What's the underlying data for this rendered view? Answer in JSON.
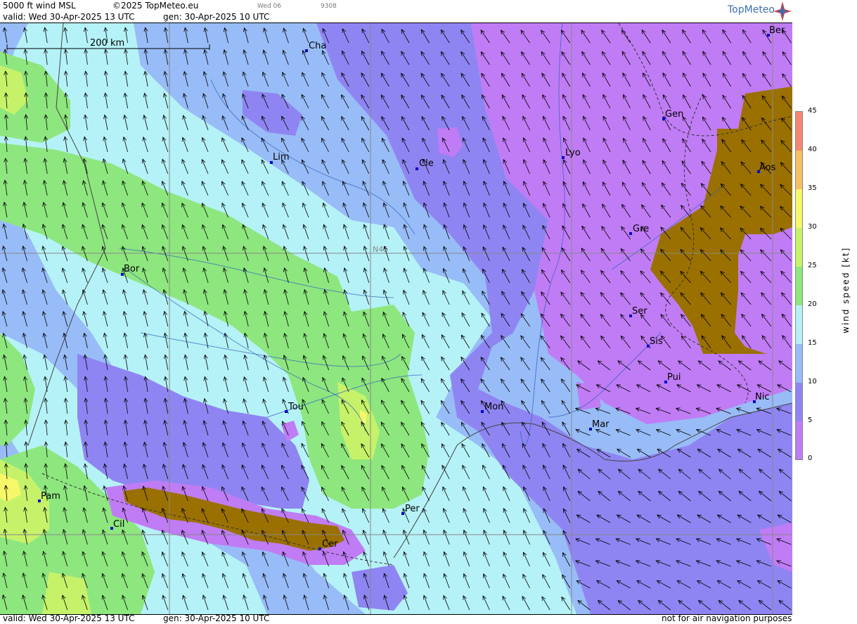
{
  "header": {
    "title": "5000 ft wind MSL",
    "copyright": "©2025 TopMeteo.eu",
    "valid": "valid:  Wed  30-Apr-2025  13 UTC",
    "gen": "gen: 30-Apr-2025 10 UTC",
    "small_day": "Wed 06",
    "small_code": "9308",
    "logo": "TopMeteo"
  },
  "footer": {
    "valid": "valid:  Wed  30-Apr-2025  13 UTC",
    "gen": "gen: 30-Apr-2025 10 UTC",
    "disclaimer": "not for air navigation purposes"
  },
  "map": {
    "scale_bar_label": "200 km",
    "lat_label": "N45",
    "cities": [
      {
        "name": "Cha"
      },
      {
        "name": "Lim"
      },
      {
        "name": "Cle"
      },
      {
        "name": "Lyo"
      },
      {
        "name": "Gen"
      },
      {
        "name": "Ber"
      },
      {
        "name": "Aos"
      },
      {
        "name": "Gre"
      },
      {
        "name": "Bor"
      },
      {
        "name": "Ser"
      },
      {
        "name": "Sis"
      },
      {
        "name": "Pui"
      },
      {
        "name": "Nic"
      },
      {
        "name": "Tou"
      },
      {
        "name": "Mon"
      },
      {
        "name": "Mar"
      },
      {
        "name": "Pam"
      },
      {
        "name": "Cil"
      },
      {
        "name": "Per"
      },
      {
        "name": "Cer"
      }
    ],
    "wind_direction": "south-southeast"
  },
  "legend": {
    "title": "wind speed [kt]",
    "ticks": [
      "45",
      "40",
      "35",
      "30",
      "25",
      "20",
      "15",
      "10",
      "5",
      "0"
    ],
    "colors": {
      "0-5": "#c07cf5",
      "5-10": "#8f85f2",
      "10-15": "#98bcf7",
      "15-20": "#b5f2f7",
      "20-25": "#8ee67e",
      "25-30": "#c6f26a",
      "30-35": "#f7f76a",
      "35-40": "#f5bf62",
      "40-45": "#f58670",
      "calm": "#9a7000"
    }
  }
}
